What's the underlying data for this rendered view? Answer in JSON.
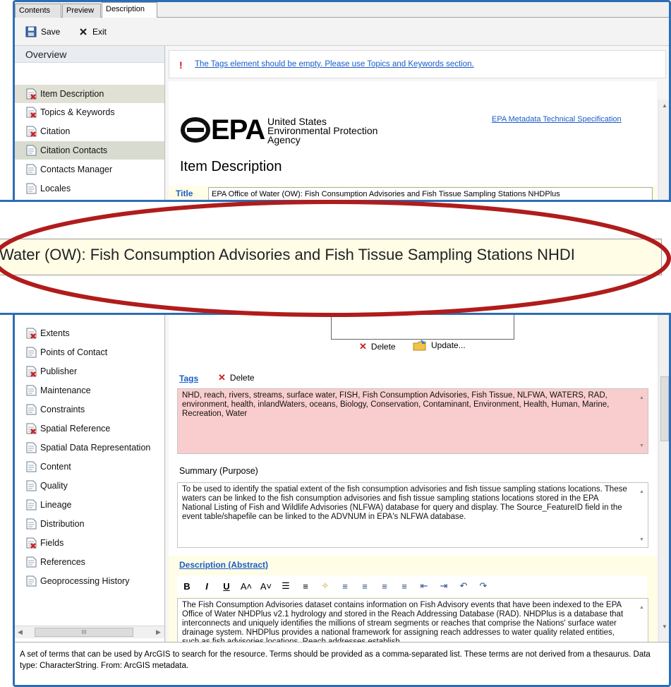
{
  "tabs": [
    {
      "label": "Contents"
    },
    {
      "label": "Preview"
    },
    {
      "label": "Description"
    }
  ],
  "toolbar": {
    "save_label": "Save",
    "exit_label": "Exit"
  },
  "sidebar": {
    "header": "Overview",
    "items": [
      {
        "label": "Item Description",
        "error": true
      },
      {
        "label": "Topics & Keywords",
        "error": true
      },
      {
        "label": "Citation",
        "error": true
      },
      {
        "label": "Citation Contacts",
        "error": false
      },
      {
        "label": "Contacts Manager",
        "error": false
      },
      {
        "label": "Locales",
        "error": false
      },
      {
        "label": "Extents",
        "error": true
      },
      {
        "label": "Points of Contact",
        "error": false
      },
      {
        "label": "Publisher",
        "error": true
      },
      {
        "label": "Maintenance",
        "error": false
      },
      {
        "label": "Constraints",
        "error": false
      },
      {
        "label": "Spatial Reference",
        "error": true
      },
      {
        "label": "Spatial Data Representation",
        "error": false
      },
      {
        "label": "Content",
        "error": false
      },
      {
        "label": "Quality",
        "error": false
      },
      {
        "label": "Lineage",
        "error": false
      },
      {
        "label": "Distribution",
        "error": false
      },
      {
        "label": "Fields",
        "error": true
      },
      {
        "label": "References",
        "error": false
      },
      {
        "label": "Geoprocessing History",
        "error": false
      }
    ],
    "hscroll_grip": "III"
  },
  "warning": {
    "icon": "!",
    "text": "The Tags element should be empty. Please use Topics and Keywords section."
  },
  "epa": {
    "logo_text": "EPA",
    "line1": "United States",
    "line2": "Environmental Protection",
    "line3": "Agency",
    "spec_link": "EPA Metadata Technical Specification"
  },
  "item_description": {
    "heading": "Item Description",
    "title_label": "Title",
    "title_value": "EPA Office of Water (OW): Fish Consumption Advisories and Fish Tissue Sampling Stations NHDPlus"
  },
  "zoom": {
    "text": "Water (OW): Fish Consumption Advisories and Fish Tissue Sampling Stations NHDI"
  },
  "thumbnail": {
    "delete_label": "Delete",
    "update_label": "Update..."
  },
  "tags": {
    "label": "Tags",
    "delete_label": "Delete",
    "value": "NHD, reach, rivers, streams, surface water, FISH, Fish Consumption Advisories, Fish Tissue, NLFWA, WATERS, RAD, environment, health, inlandWaters, oceans, Biology, Conservation, Contaminant, Environment, Health, Human, Marine, Recreation, Water"
  },
  "summary": {
    "label": "Summary (Purpose)",
    "value": "To be used to identify the spatial extent of the fish consumption advisories and fish tissue sampling stations locations. These waters can be linked to the fish consumption advisories and fish tissue sampling stations locations stored in the EPA National Listing of Fish and Wildlife Advisories (NLFWA) database for query and display. The Source_FeatureID field in the event table/shapefile can be linked to the ADVNUM in EPA's NLFWA database."
  },
  "description": {
    "label": "Description (Abstract)",
    "value": "The Fish Consumption Advisories dataset contains information on Fish Advisory events that have been indexed to the EPA Office of Water NHDPlus v2.1 hydrology and stored in the Reach Addressing Database (RAD). NHDPlus is a database that interconnects and uniquely identifies the millions of stream segments or reaches that comprise the Nations' surface water drainage system. NHDPlus provides a national framework for assigning reach addresses to water quality related entities, such as fish advisories locations. Reach addresses establish"
  },
  "rte_buttons": [
    "B",
    "I",
    "U",
    "A˄",
    "A˅",
    "☰",
    "≡",
    "✧",
    "≡",
    "≡",
    "≡",
    "≡",
    "⇤",
    "⇥",
    "↶",
    "↷"
  ],
  "status": {
    "text": "A set of terms that can be used by ArcGIS to search for the resource. Terms should be provided as a comma-separated list. These terms are not derived from a thesaurus. Data type: CharacterString. From: ArcGIS metadata."
  },
  "colors": {
    "frame": "#2e6db4",
    "oval": "#b01c1c",
    "link": "#1a5cc8",
    "tags_bg": "#f9cdcd",
    "yellow": "#fffde6"
  }
}
